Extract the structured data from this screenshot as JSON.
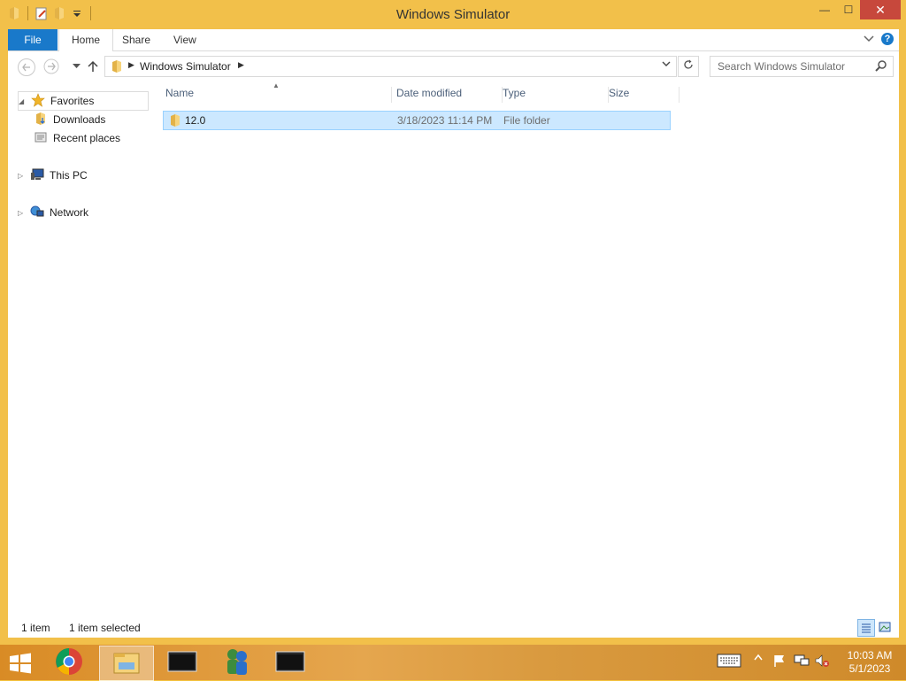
{
  "window": {
    "title": "Windows Simulator",
    "controls": {
      "minimize": "—",
      "maximize": "☐",
      "close": "✕"
    }
  },
  "ribbon": {
    "tabs": [
      "File",
      "Home",
      "Share",
      "View"
    ],
    "help": "?"
  },
  "navigation": {
    "breadcrumb": [
      "Windows Simulator"
    ],
    "search_placeholder": "Search Windows Simulator"
  },
  "nav_pane": {
    "favorites": "Favorites",
    "downloads": "Downloads",
    "recent_places": "Recent places",
    "this_pc": "This PC",
    "network": "Network"
  },
  "file_list": {
    "columns": [
      "Name",
      "Date modified",
      "Type",
      "Size"
    ],
    "rows": [
      {
        "name": "12.0",
        "date": "3/18/2023 11:14 PM",
        "type": "File folder",
        "size": ""
      }
    ]
  },
  "status": {
    "items": "1 item",
    "selected": "1 item selected"
  },
  "taskbar": {
    "apps": [
      "chrome-icon",
      "file-explorer-icon",
      "terminal-window-icon",
      "people-app-icon",
      "terminal-window-icon"
    ],
    "time": "10:03 AM",
    "date": "5/1/2023"
  },
  "colors": {
    "frame": "#f2c04a",
    "accent": "#1979ca",
    "selection": "#cce8ff",
    "close": "#c7483c"
  }
}
